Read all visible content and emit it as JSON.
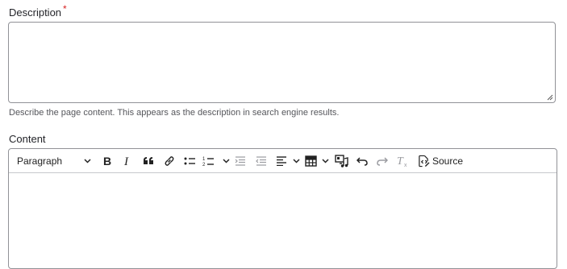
{
  "description_field": {
    "label": "Description",
    "required_marker": "*",
    "value": "",
    "help_text": "Describe the page content. This appears as the description in search engine results."
  },
  "content_field": {
    "label": "Content",
    "toolbar": {
      "heading_select_value": "Paragraph",
      "source_label": "Source",
      "icons": [
        "chevron-down-icon",
        "bold-icon",
        "italic-icon",
        "blockquote-icon",
        "link-icon",
        "bulleted-list-icon",
        "numbered-list-icon",
        "chevron-down-icon",
        "outdent-icon",
        "indent-icon",
        "align-icon",
        "chevron-down-icon",
        "table-icon",
        "chevron-down-icon",
        "media-icon",
        "undo-icon",
        "redo-icon",
        "remove-format-icon",
        "source-icon"
      ]
    },
    "value": ""
  },
  "colors": {
    "required": "#d72222",
    "border": "#919297",
    "disabled_icon": "#9a9ba0"
  }
}
